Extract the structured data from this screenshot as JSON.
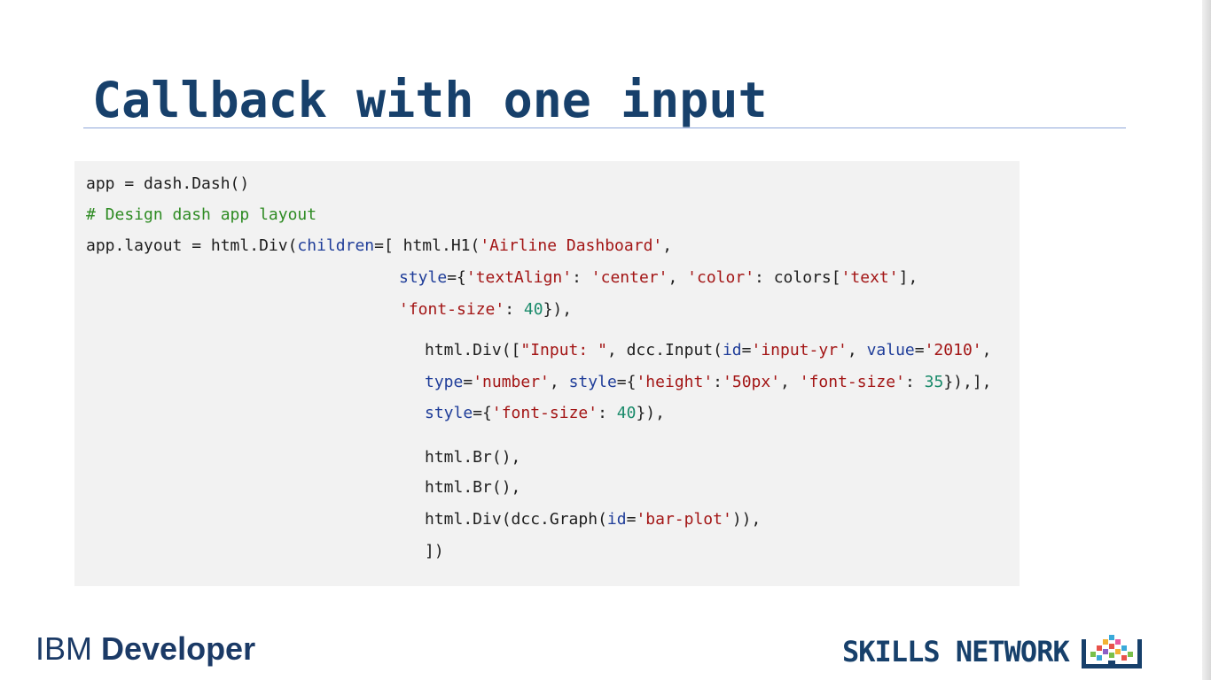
{
  "slide": {
    "title": "Callback with one input"
  },
  "code": {
    "lines": [
      {
        "tokens": [
          {
            "t": "app = dash.Dash()",
            "c": "plain"
          }
        ]
      },
      {
        "tokens": [
          {
            "t": "# Design dash app layout",
            "c": "comment"
          }
        ]
      },
      {
        "tokens": [
          {
            "t": "app.layout = html.Div(",
            "c": "plain"
          },
          {
            "t": "children",
            "c": "kw"
          },
          {
            "t": "=[ html.H1(",
            "c": "plain"
          },
          {
            "t": "'Airline Dashboard'",
            "c": "string"
          },
          {
            "t": ",",
            "c": "plain"
          }
        ]
      },
      {
        "tokens": [
          {
            "t": "style",
            "c": "kw"
          },
          {
            "t": "={",
            "c": "plain"
          },
          {
            "t": "'textAlign'",
            "c": "string"
          },
          {
            "t": ": ",
            "c": "plain"
          },
          {
            "t": "'center'",
            "c": "string"
          },
          {
            "t": ", ",
            "c": "plain"
          },
          {
            "t": "'color'",
            "c": "string"
          },
          {
            "t": ": colors[",
            "c": "plain"
          },
          {
            "t": "'text'",
            "c": "string"
          },
          {
            "t": "],",
            "c": "plain"
          }
        ]
      },
      {
        "tokens": [
          {
            "t": "'font-size'",
            "c": "string"
          },
          {
            "t": ": ",
            "c": "plain"
          },
          {
            "t": "40",
            "c": "num"
          },
          {
            "t": "}),",
            "c": "plain"
          }
        ]
      },
      {
        "tokens": [
          {
            "t": "html.Div([",
            "c": "plain"
          },
          {
            "t": "\"Input: \"",
            "c": "string"
          },
          {
            "t": ", dcc.Input(",
            "c": "plain"
          },
          {
            "t": "id",
            "c": "kw"
          },
          {
            "t": "=",
            "c": "plain"
          },
          {
            "t": "'input-yr'",
            "c": "string"
          },
          {
            "t": ", ",
            "c": "plain"
          },
          {
            "t": "value",
            "c": "kw"
          },
          {
            "t": "=",
            "c": "plain"
          },
          {
            "t": "'2010'",
            "c": "string"
          },
          {
            "t": ",",
            "c": "plain"
          }
        ]
      },
      {
        "tokens": [
          {
            "t": "type",
            "c": "kw"
          },
          {
            "t": "=",
            "c": "plain"
          },
          {
            "t": "'number'",
            "c": "string"
          },
          {
            "t": ", ",
            "c": "plain"
          },
          {
            "t": "style",
            "c": "kw"
          },
          {
            "t": "={",
            "c": "plain"
          },
          {
            "t": "'height'",
            "c": "string"
          },
          {
            "t": ":",
            "c": "plain"
          },
          {
            "t": "'50px'",
            "c": "string"
          },
          {
            "t": ", ",
            "c": "plain"
          },
          {
            "t": "'font-size'",
            "c": "string"
          },
          {
            "t": ": ",
            "c": "plain"
          },
          {
            "t": "35",
            "c": "num"
          },
          {
            "t": "}),],",
            "c": "plain"
          }
        ]
      },
      {
        "tokens": [
          {
            "t": "style",
            "c": "kw"
          },
          {
            "t": "={",
            "c": "plain"
          },
          {
            "t": "'font-size'",
            "c": "string"
          },
          {
            "t": ": ",
            "c": "plain"
          },
          {
            "t": "40",
            "c": "num"
          },
          {
            "t": "}),",
            "c": "plain"
          }
        ]
      },
      {
        "tokens": [
          {
            "t": "html.Br(),",
            "c": "plain"
          }
        ]
      },
      {
        "tokens": [
          {
            "t": "html.Br(),",
            "c": "plain"
          }
        ]
      },
      {
        "tokens": [
          {
            "t": "html.Div(dcc.Graph(",
            "c": "plain"
          },
          {
            "t": "id",
            "c": "kw"
          },
          {
            "t": "=",
            "c": "plain"
          },
          {
            "t": "'bar-plot'",
            "c": "string"
          },
          {
            "t": ")),",
            "c": "plain"
          }
        ]
      },
      {
        "tokens": [
          {
            "t": "])",
            "c": "plain"
          }
        ]
      }
    ]
  },
  "footer": {
    "ibm_light": "IBM ",
    "ibm_bold": "Developer",
    "skills": "SKILLS NETWORK"
  },
  "colors": {
    "title": "#17406b",
    "comment": "#2e8b23",
    "string": "#a31515",
    "keyword": "#1f3d99",
    "number": "#198a6a",
    "code_bg": "#f2f2f2"
  },
  "icons": {
    "skills_network": "book-pixels-icon"
  }
}
